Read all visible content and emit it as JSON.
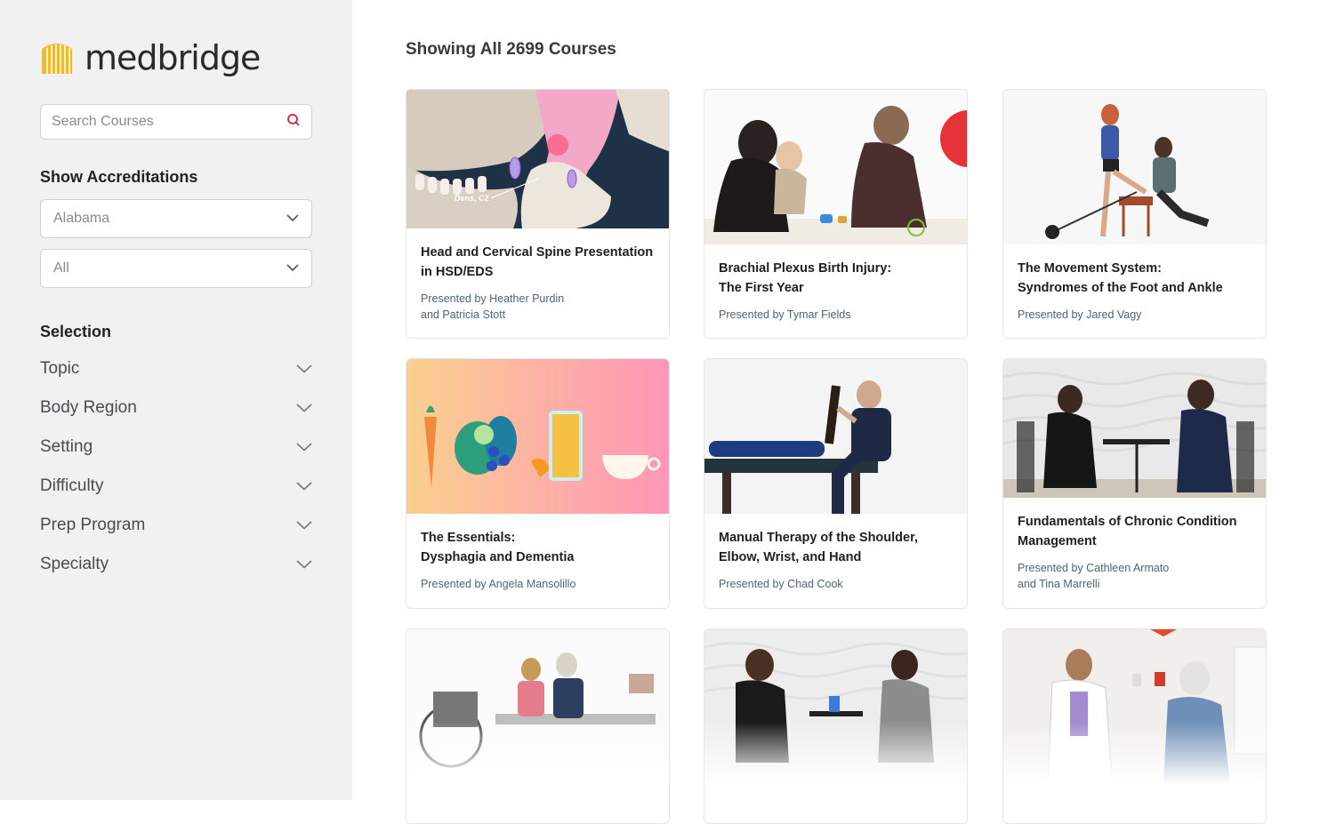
{
  "brand": {
    "name": "medbridge",
    "accent": "#f5b921"
  },
  "search": {
    "placeholder": "Search Courses"
  },
  "accreditations": {
    "title": "Show Accreditations",
    "state_selected": "Alabama",
    "profession_selected": "All"
  },
  "selection": {
    "title": "Selection",
    "filters": [
      "Topic",
      "Body Region",
      "Setting",
      "Difficulty",
      "Prep Program",
      "Specialty"
    ]
  },
  "main": {
    "heading": "Showing All 2699 Courses",
    "courses": [
      {
        "title": "Head and Cervical Spine Presentation\nin HSD/EDS",
        "presenter": "Presented by Heather Purdin\nand Patricia Stott",
        "image_label": "Dens, C2"
      },
      {
        "title": "Brachial Plexus Birth Injury:\nThe First Year",
        "presenter": "Presented by Tymar Fields"
      },
      {
        "title": "The Movement System:\nSyndromes of the Foot and Ankle",
        "presenter": "Presented by Jared Vagy"
      },
      {
        "title": "The Essentials:\nDysphagia and Dementia",
        "presenter": "Presented by Angela Mansolillo"
      },
      {
        "title": "Manual Therapy of the Shoulder,\nElbow, Wrist, and Hand",
        "presenter": "Presented by Chad Cook"
      },
      {
        "title": "Fundamentals of Chronic Condition\nManagement",
        "presenter": "Presented by Cathleen Armato\nand Tina Marrelli"
      },
      {
        "title": "",
        "presenter": ""
      },
      {
        "title": "",
        "presenter": ""
      },
      {
        "title": "",
        "presenter": ""
      }
    ]
  }
}
